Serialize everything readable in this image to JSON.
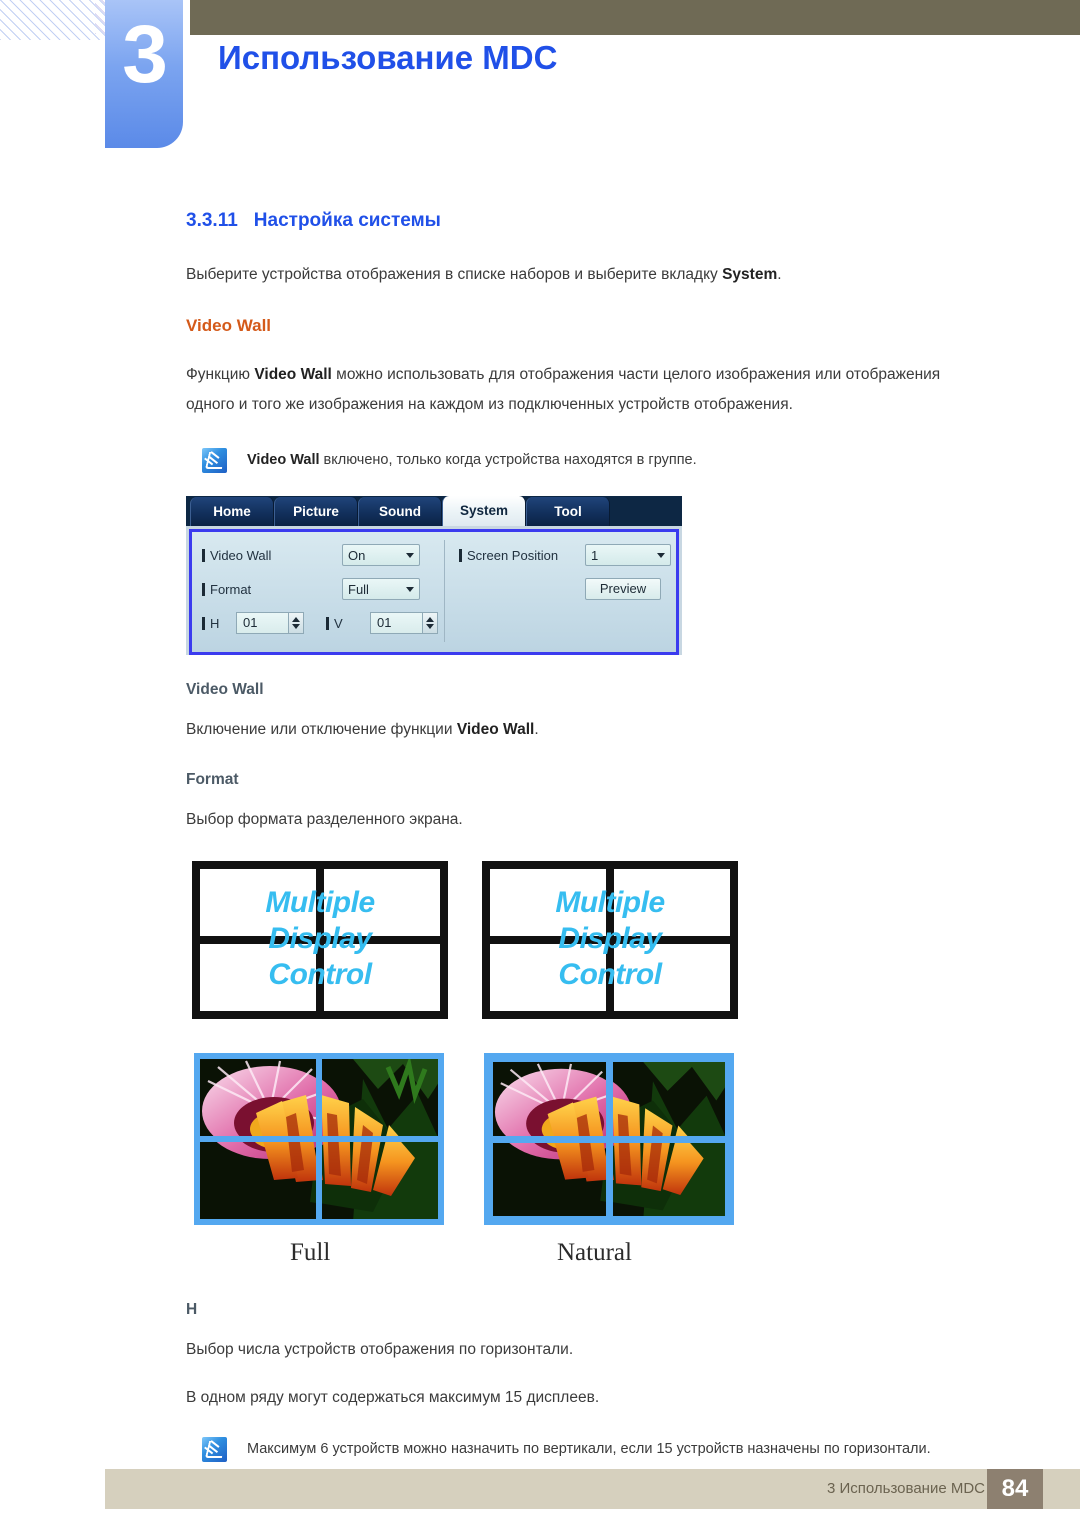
{
  "header": {
    "chapter_number": "3",
    "chapter_title": "Использование MDC"
  },
  "section": {
    "number": "3.3.11",
    "title": "Настройка системы",
    "intro_prefix": "Выберите устройства отображения в списке наборов и выберите вкладку ",
    "intro_bold": "System",
    "intro_suffix": "."
  },
  "video_wall_heading": "Video Wall",
  "video_wall_desc_1": "Функцию ",
  "video_wall_desc_bold": "Video Wall",
  "video_wall_desc_2": " можно использовать для отображения части целого изображения или отображения одного и того же изображения на каждом из подключенных устройств отображения.",
  "note_1": {
    "icon": "note-pen-icon",
    "bold": "Video Wall",
    "text": " включено, только когда устройства находятся в группе."
  },
  "mdc": {
    "tabs": [
      {
        "label": "Home",
        "active": false
      },
      {
        "label": "Picture",
        "active": false
      },
      {
        "label": "Sound",
        "active": false
      },
      {
        "label": "System",
        "active": true
      },
      {
        "label": "Tool",
        "active": false
      }
    ],
    "fields": {
      "video_wall_label": "Video Wall",
      "video_wall_value": "On",
      "format_label": "Format",
      "format_value": "Full",
      "h_label": "H",
      "h_value": "01",
      "v_label": "V",
      "v_value": "01",
      "screen_position_label": "Screen Position",
      "screen_position_value": "1",
      "preview_button": "Preview"
    }
  },
  "subsections": [
    {
      "heading": "Video Wall",
      "text_prefix": "Включение или отключение функции ",
      "text_bold": "Video Wall",
      "text_suffix": "."
    },
    {
      "heading": "Format",
      "text_prefix": "Выбор формата разделенного экрана.",
      "text_bold": "",
      "text_suffix": ""
    }
  ],
  "wall_diagrams": {
    "text_line_1": "Multiple",
    "text_line_2": "Display",
    "text_line_3": "Control",
    "accent_color": "#36bdf0"
  },
  "photo_captions": {
    "full": "Full",
    "natural": "Natural"
  },
  "h_section": {
    "heading": "H",
    "line_1": "Выбор числа устройств отображения по горизонтали.",
    "line_2": "В одном ряду могут содержаться максимум 15 дисплеев."
  },
  "note_2": {
    "icon": "note-pen-icon",
    "text": "Максимум 6 устройств можно назначить по вертикали, если 15 устройств назначены по горизонтали."
  },
  "footer": {
    "text": "3 Использование MDC",
    "page": "84"
  }
}
